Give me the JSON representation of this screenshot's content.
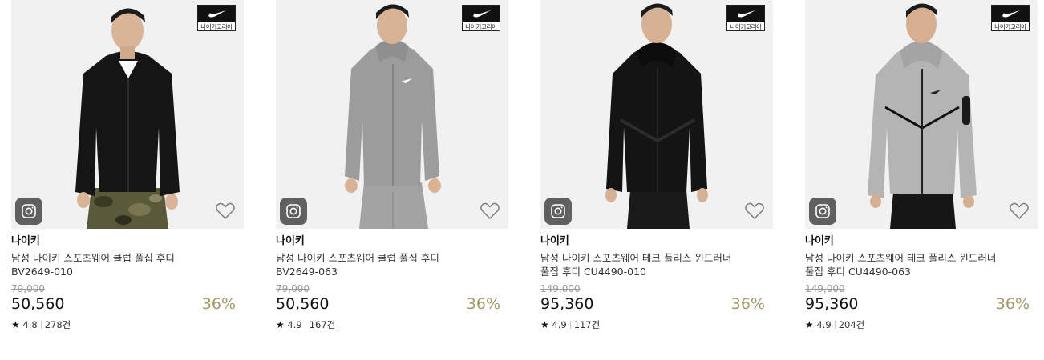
{
  "badge": {
    "brand_text": "나이키코리아"
  },
  "products": [
    {
      "brand": "나이키",
      "name": "남성 나이키 스포츠웨어 클럽 풀집 후디",
      "code": "BV2649-010",
      "original_price": "79,000",
      "price": "50,560",
      "discount": "36%",
      "rating": "4.8",
      "reviews": "278건",
      "hoodie_color": "#151515",
      "pants": "camo"
    },
    {
      "brand": "나이키",
      "name": "남성 나이키 스포츠웨어 클럽 풀집 후디",
      "code": "BV2649-063",
      "original_price": "79,000",
      "price": "50,560",
      "discount": "36%",
      "rating": "4.9",
      "reviews": "167건",
      "hoodie_color": "#9c9c9c",
      "pants": "grey"
    },
    {
      "brand": "나이키",
      "name": "남성 나이키 스포츠웨어 테크 플리스 윈드러너",
      "code": "풀집 후디 CU4490-010",
      "original_price": "149,000",
      "price": "95,360",
      "discount": "36%",
      "rating": "4.9",
      "reviews": "117건",
      "hoodie_color": "#141414",
      "pants": "black"
    },
    {
      "brand": "나이키",
      "name": "남성 나이키 스포츠웨어 테크 플리스 윈드러너",
      "code": "풀집 후디 CU4490-063",
      "original_price": "149,000",
      "price": "95,360",
      "discount": "36%",
      "rating": "4.9",
      "reviews": "204건",
      "hoodie_color": "#b4b4b4",
      "pants": "black"
    }
  ],
  "colors": {
    "discount": "#a89865",
    "strike": "#999999",
    "accent_dark": "#111111"
  },
  "icons": {
    "instagram": "instagram-icon",
    "wishlist": "heart-icon",
    "star": "star-icon",
    "brand_logo": "swoosh-icon"
  }
}
